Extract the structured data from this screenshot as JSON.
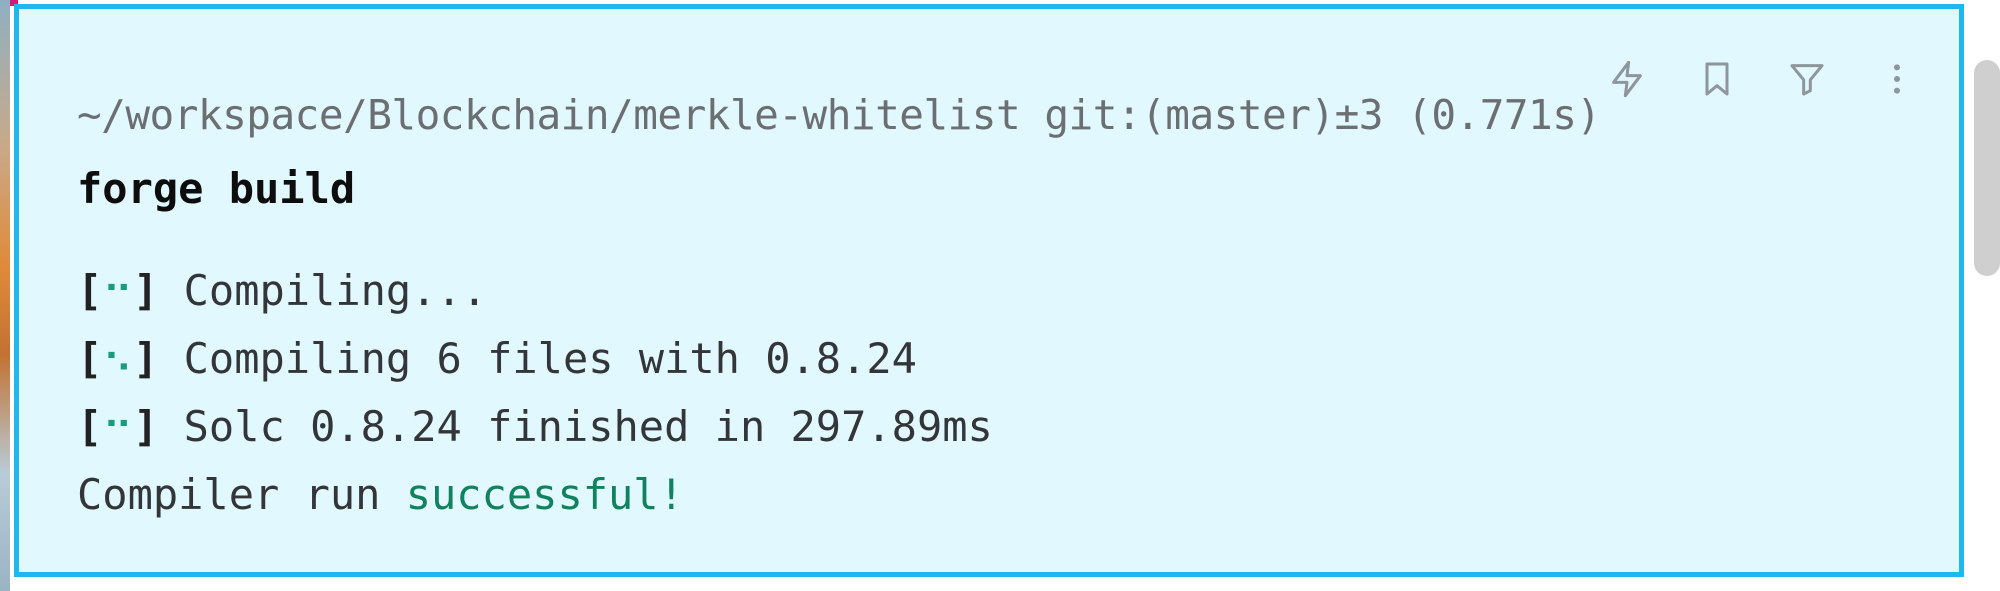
{
  "prompt": {
    "path": "~/workspace/Blockchain/merkle-whitelist",
    "git": "git:(master)±3",
    "duration": "(0.771s)"
  },
  "command": "forge build",
  "output": [
    {
      "open": "[",
      "spinner": "⠒",
      "close": "]",
      "text": " Compiling..."
    },
    {
      "open": "[",
      "spinner": "⠢",
      "close": "]",
      "text": " Compiling 6 files with 0.8.24"
    },
    {
      "open": "[",
      "spinner": "⠒",
      "close": "]",
      "text": " Solc 0.8.24 finished in 297.89ms"
    }
  ],
  "result": {
    "prefix": "Compiler run ",
    "status": "successful!"
  },
  "toolbar": {
    "icons": [
      "lightning-icon",
      "bookmark-icon",
      "filter-icon",
      "more-vertical-icon"
    ]
  },
  "colors": {
    "block_background": "#e0f8fe",
    "block_border": "#1fb8ee",
    "success": "#10825e",
    "spinner": "#1a9a80"
  }
}
